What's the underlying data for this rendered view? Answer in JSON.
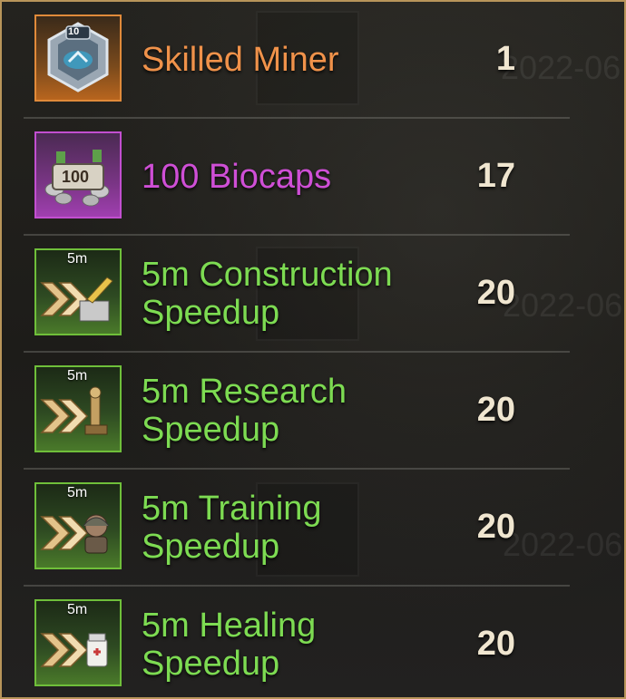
{
  "colors": {
    "orange": "#f0924a",
    "purple": "#cf4fd6",
    "green": "#7ddb52",
    "frame": "#b8955a"
  },
  "background_stamps": [
    "2022-06",
    "2022-06",
    "2022-06"
  ],
  "items": [
    {
      "name": "Skilled Miner",
      "quantity": "1",
      "rarity": "orange",
      "icon": "skilled-miner-badge-icon",
      "badge": "10"
    },
    {
      "name": "100 Biocaps",
      "quantity": "17",
      "rarity": "purple",
      "icon": "biocaps-pile-icon",
      "badge": "100"
    },
    {
      "name": "5m Construction Speedup",
      "quantity": "20",
      "rarity": "green",
      "icon": "construction-speedup-icon",
      "tag": "5m"
    },
    {
      "name": "5m Research Speedup",
      "quantity": "20",
      "rarity": "green",
      "icon": "research-speedup-icon",
      "tag": "5m"
    },
    {
      "name": "5m Training Speedup",
      "quantity": "20",
      "rarity": "green",
      "icon": "training-speedup-icon",
      "tag": "5m"
    },
    {
      "name": "5m Healing Speedup",
      "quantity": "20",
      "rarity": "green",
      "icon": "healing-speedup-icon",
      "tag": "5m"
    }
  ]
}
